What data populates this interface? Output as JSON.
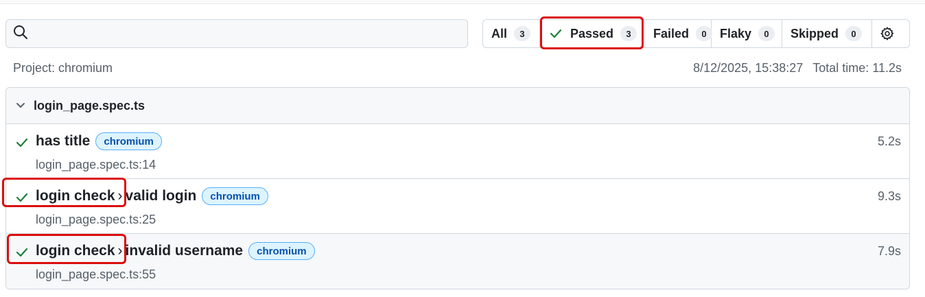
{
  "search": {
    "placeholder": "",
    "value": ""
  },
  "filters": [
    {
      "label": "All",
      "count": "3"
    },
    {
      "label": "Passed",
      "count": "3"
    },
    {
      "label": "Failed",
      "count": "0"
    },
    {
      "label": "Flaky",
      "count": "0"
    },
    {
      "label": "Skipped",
      "count": "0"
    }
  ],
  "meta": {
    "project": "Project: chromium",
    "datetime": "8/12/2025, 15:38:27",
    "total_time": "Total time: 11.2s"
  },
  "file": {
    "name": "login_page.spec.ts",
    "tests": [
      {
        "path": "",
        "title": "has title",
        "tag": "chromium",
        "location": "login_page.spec.ts:14",
        "duration": "5.2s"
      },
      {
        "path": "login check",
        "title": "valid login",
        "tag": "chromium",
        "location": "login_page.spec.ts:25",
        "duration": "9.3s"
      },
      {
        "path": "login check",
        "title": "invalid username",
        "tag": "chromium",
        "location": "login_page.spec.ts:55",
        "duration": "7.9s"
      }
    ]
  },
  "colors": {
    "pass_green": "#1a7f37",
    "highlight_red": "#dc0d0d",
    "tag_blue": "#0550ae"
  },
  "icons": [
    "search-icon",
    "check-icon",
    "gear-icon",
    "chevron-down-icon"
  ]
}
